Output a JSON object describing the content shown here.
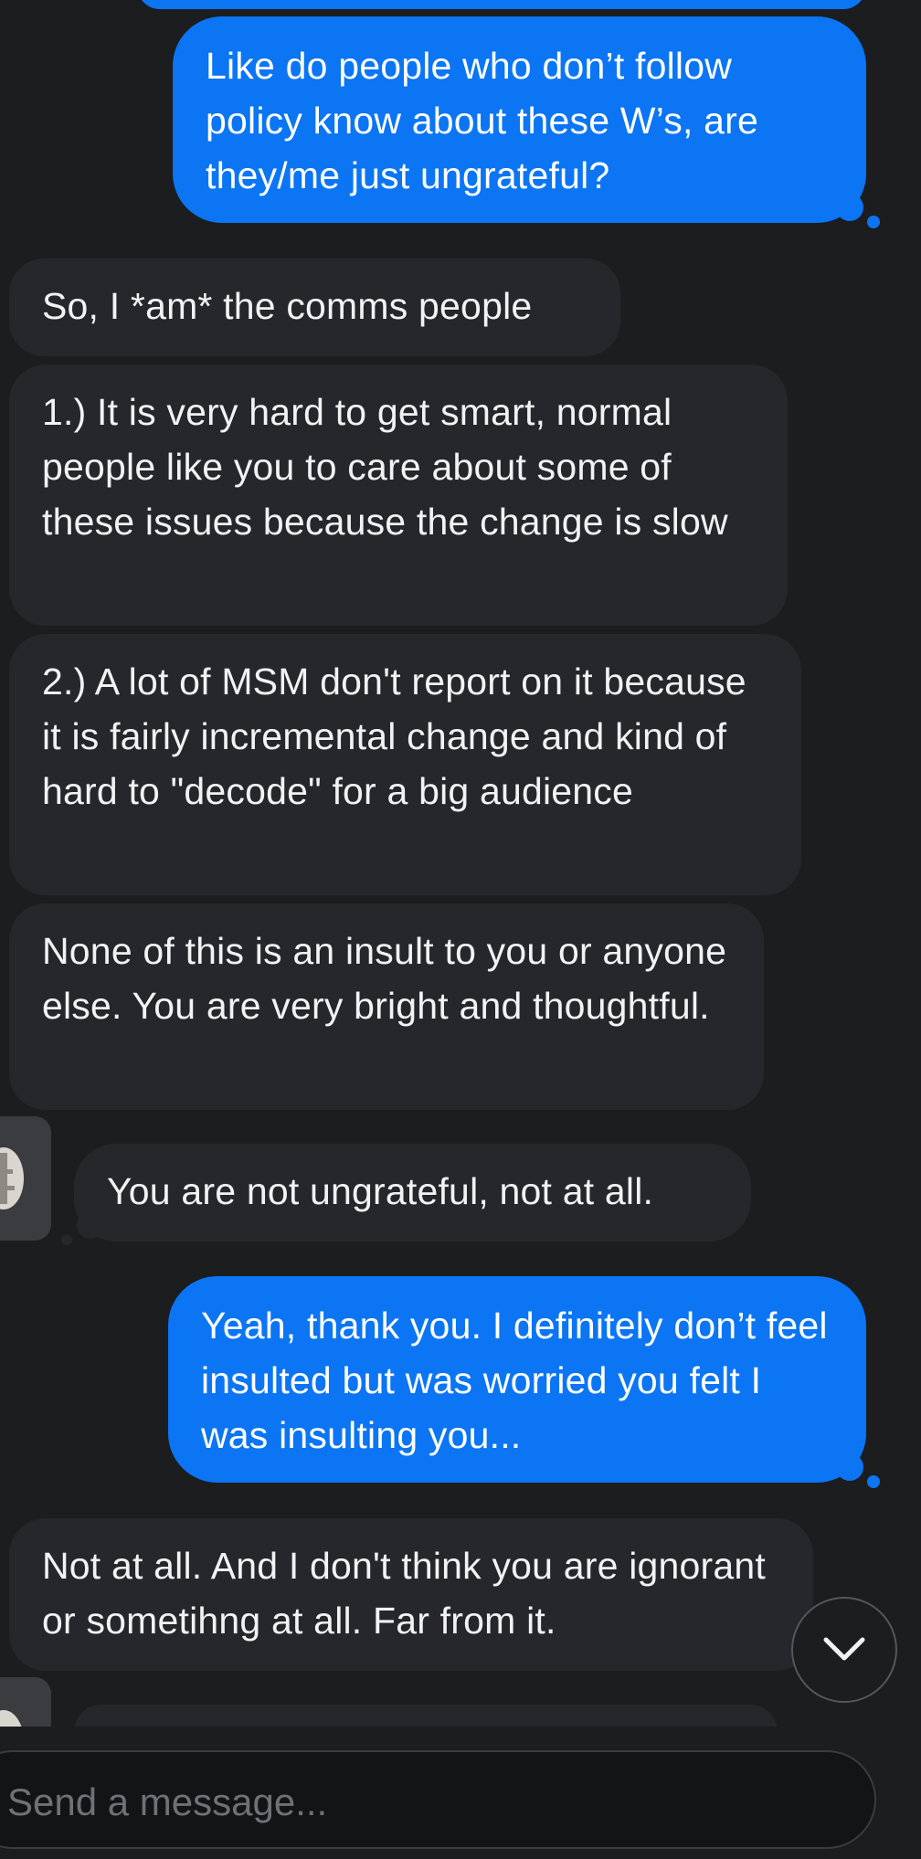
{
  "messages": [
    {
      "id": "m1",
      "sender": "me",
      "text": "Like do people who don’t follow policy know about these W’s, are they/me just ungrateful?"
    },
    {
      "id": "m2",
      "sender": "them",
      "text": "So, I *am* the comms people"
    },
    {
      "id": "m3",
      "sender": "them",
      "text": "1.) It is very hard to get smart, normal people like you to care about some of these issues because the change is slow"
    },
    {
      "id": "m4",
      "sender": "them",
      "text": "2.) A lot of MSM don't report on it because it is fairly incremental change and kind of hard to \"decode\" for a big audience"
    },
    {
      "id": "m5",
      "sender": "them",
      "text": "None of this is an insult to you or anyone else. You are very bright and thoughtful."
    },
    {
      "id": "m6",
      "sender": "them",
      "text": "You are not ungrateful, not at all."
    },
    {
      "id": "m7",
      "sender": "me",
      "text": "Yeah, thank you. I definitely don’t feel insulted but was worried you felt I was insulting you..."
    },
    {
      "id": "m8",
      "sender": "them",
      "text": "Not at all. And I don't think you are ignorant or sometihng at all. Far from it."
    }
  ],
  "composer": {
    "placeholder": "Send a message..."
  },
  "icons": {
    "scroll_down": "chevron-down-icon",
    "avatar": "contact-avatar"
  },
  "colors": {
    "background": "#1c1d1f",
    "incoming_bubble": "#25272a",
    "outgoing_bubble": "#0b75f4",
    "text": "#f2f2f4",
    "placeholder": "#6f7176"
  }
}
